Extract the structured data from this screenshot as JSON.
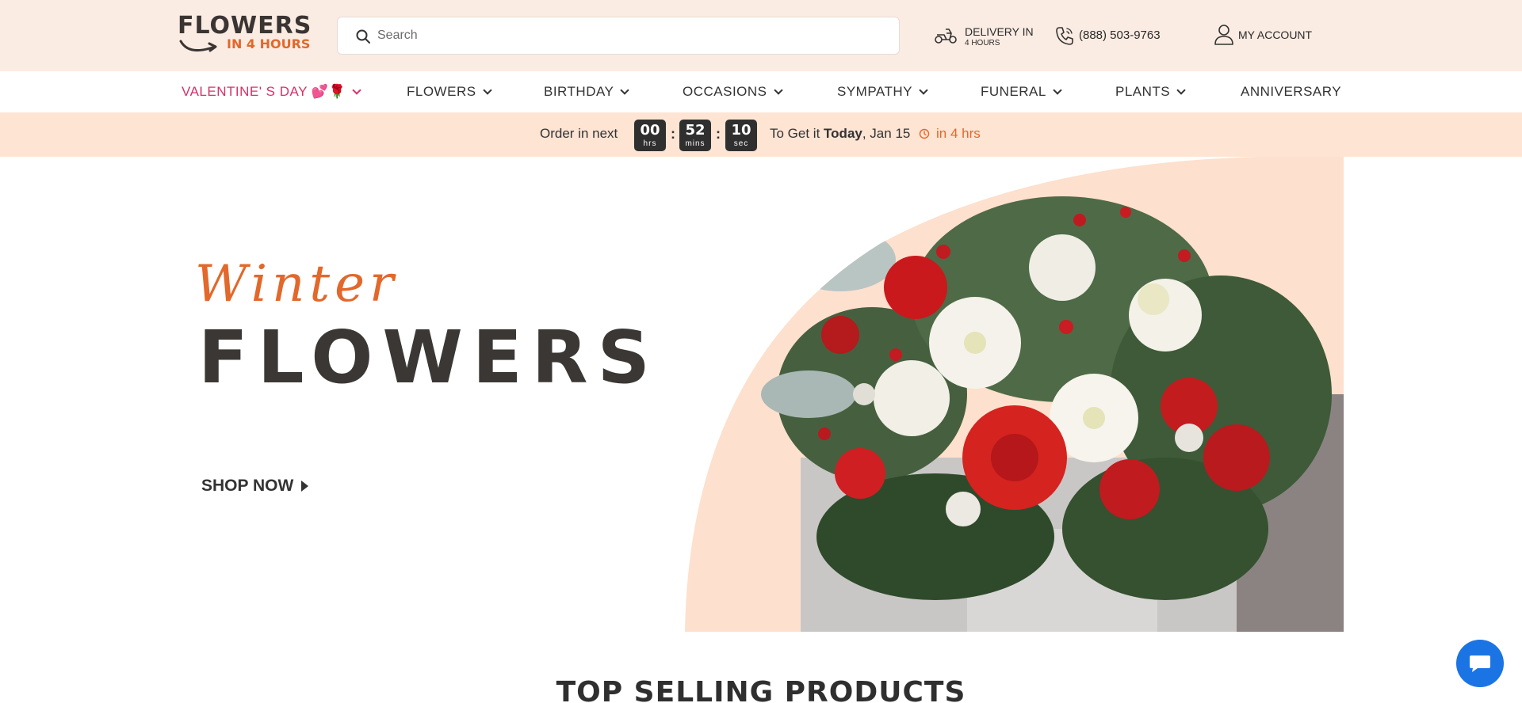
{
  "header": {
    "logo": {
      "line1": "FLOWERS",
      "line2": "IN 4 HOURS"
    },
    "search": {
      "placeholder": "Search"
    },
    "delivery": {
      "line1": "DELIVERY IN",
      "line2": "4 HOURS",
      "icon": "delivery-scooter-icon"
    },
    "phone": {
      "number": "(888) 503-9763",
      "icon": "phone-icon"
    },
    "account": {
      "label": "MY ACCOUNT",
      "icon": "user-icon"
    }
  },
  "nav": {
    "items": [
      {
        "label": "VALENTINE' S DAY 💕🌹",
        "has_dropdown": true
      },
      {
        "label": "FLOWERS",
        "has_dropdown": true
      },
      {
        "label": "BIRTHDAY",
        "has_dropdown": true
      },
      {
        "label": "OCCASIONS",
        "has_dropdown": true
      },
      {
        "label": "SYMPATHY",
        "has_dropdown": true
      },
      {
        "label": "FUNERAL",
        "has_dropdown": true
      },
      {
        "label": "PLANTS",
        "has_dropdown": true
      },
      {
        "label": "ANNIVERSARY",
        "has_dropdown": false
      }
    ]
  },
  "countdown": {
    "prefix": "Order in next",
    "hours": {
      "value": "00",
      "unit": "hrs"
    },
    "minutes": {
      "value": "52",
      "unit": "mins"
    },
    "seconds": {
      "value": "10",
      "unit": "sec"
    },
    "separator": ":",
    "get_prefix": "To Get it",
    "day": "Today",
    "date": ", Jan 15",
    "eta": "in 4 hrs"
  },
  "hero": {
    "script": "Winter",
    "title": "FLOWERS",
    "cta": "SHOP NOW"
  },
  "section": {
    "title": "TOP SELLING PRODUCTS"
  },
  "colors": {
    "accent_orange": "#e2682b",
    "valentine_pink": "#d63268",
    "header_bg": "#fbece3",
    "countdown_bg": "#fde4d3",
    "chat_blue": "#1b74e4"
  }
}
